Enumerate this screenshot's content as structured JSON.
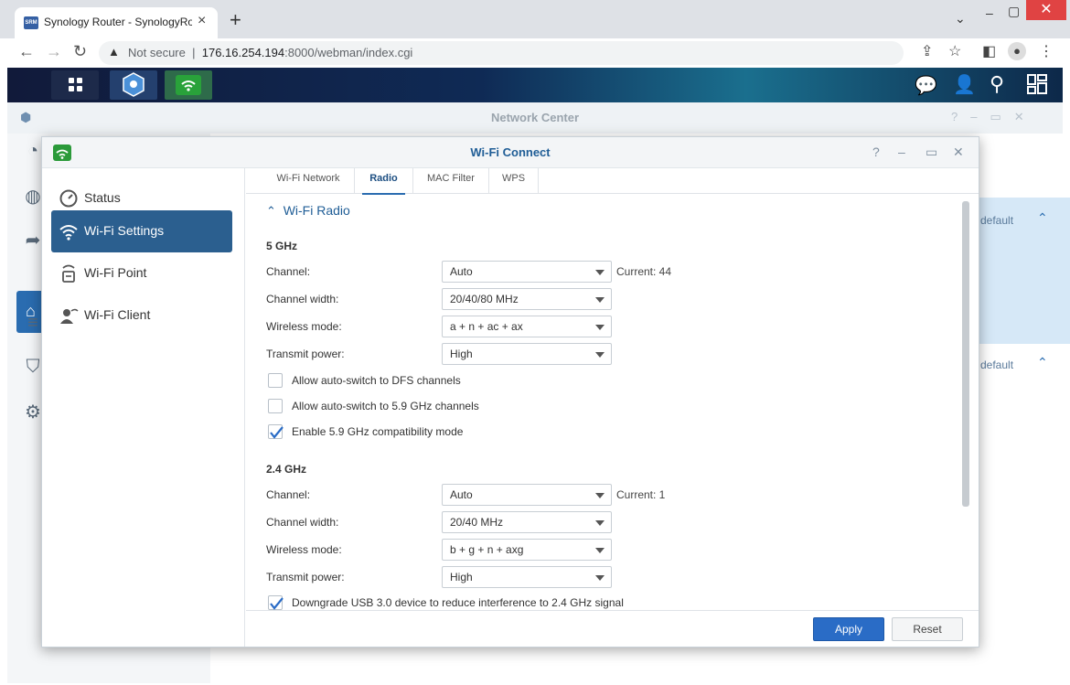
{
  "browser": {
    "tab_title": "Synology Router - SynologyRouter",
    "favicon_text": "SRM",
    "security_label": "Not secure",
    "url_host": "176.16.254.194",
    "url_path": ":8000/webman/index.cgi"
  },
  "network_center": {
    "title": "Network Center",
    "restore_default_1": "default",
    "restore_default_2": "default"
  },
  "window": {
    "title": "Wi-Fi Connect",
    "sidebar": [
      {
        "label": "Status"
      },
      {
        "label": "Wi-Fi Settings",
        "active": true
      },
      {
        "label": "Wi-Fi Point"
      },
      {
        "label": "Wi-Fi Client"
      }
    ],
    "tabs": [
      {
        "label": "Wi-Fi Network"
      },
      {
        "label": "Radio",
        "active": true
      },
      {
        "label": "MAC Filter"
      },
      {
        "label": "WPS"
      }
    ],
    "section_title": "Wi-Fi Radio",
    "band_5": {
      "header": "5 GHz",
      "channel_label": "Channel:",
      "channel_value": "Auto",
      "channel_current": "Current: 44",
      "width_label": "Channel width:",
      "width_value": "20/40/80 MHz",
      "mode_label": "Wireless mode:",
      "mode_value": "a + n + ac + ax",
      "power_label": "Transmit power:",
      "power_value": "High",
      "dfs_label": "Allow auto-switch to DFS channels",
      "dfs_checked": false,
      "ghz59_label": "Allow auto-switch to 5.9 GHz channels",
      "ghz59_checked": false,
      "compat_label": "Enable 5.9 GHz compatibility mode",
      "compat_checked": true
    },
    "band_24": {
      "header": "2.4 GHz",
      "channel_label": "Channel:",
      "channel_value": "Auto",
      "channel_current": "Current: 1",
      "width_label": "Channel width:",
      "width_value": "20/40 MHz",
      "mode_label": "Wireless mode:",
      "mode_value": "b + g + n + axg",
      "power_label": "Transmit power:",
      "power_value": "High",
      "usb_label": "Downgrade USB 3.0 device to reduce interference to 2.4 GHz signal",
      "usb_checked": true
    },
    "apply_label": "Apply",
    "reset_label": "Reset"
  },
  "icons": [
    "back-icon",
    "forward-icon",
    "reload-icon",
    "warning-icon",
    "share-icon",
    "star-icon",
    "sidepanel-icon",
    "profile-icon",
    "menu-icon",
    "apps-icon",
    "network-center-icon",
    "wifi-connect-icon",
    "chat-icon",
    "user-icon",
    "search-icon",
    "widgets-icon"
  ],
  "colors": {
    "accent": "#2b5f8f",
    "primary_button": "#2a6cc6",
    "wifi_green": "#2b9a3a"
  }
}
